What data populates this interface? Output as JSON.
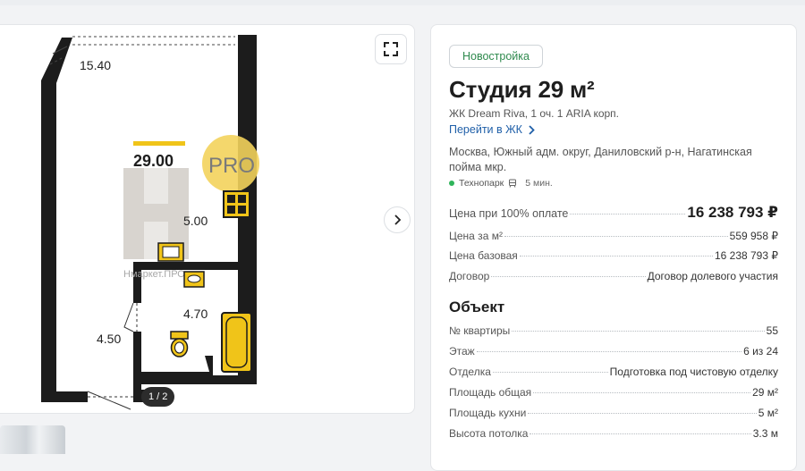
{
  "plan": {
    "dim_top": "15.40",
    "total_area": "29.00",
    "pro_label": "PRO",
    "kitchen_area": "5.00",
    "watermark": "Нмаркет.ПРО",
    "bath_area": "4.70",
    "hall_area": "4.50",
    "pager": "1 / 2"
  },
  "listing": {
    "badge": "Новостройка",
    "title": "Студия 29 м²",
    "subtitle": "ЖК Dream Riva, 1 оч. 1 ARIA корп.",
    "link": "Перейти в ЖК",
    "address": "Москва, Южный адм. округ, Даниловский р-н, Нагатинская пойма мкр.",
    "metro": {
      "station": "Технопарк",
      "time": "5 мин.",
      "color": "#2fb45a"
    }
  },
  "prices": [
    {
      "label": "Цена при 100% оплате",
      "value": "16 238 793 ₽"
    },
    {
      "label": "Цена за м²",
      "value": "559 958 ₽"
    },
    {
      "label": "Цена базовая",
      "value": "16 238 793 ₽"
    },
    {
      "label": "Договор",
      "value": "Договор долевого участия"
    }
  ],
  "object": {
    "heading": "Объект",
    "rows": [
      {
        "label": "№ квартиры",
        "value": "55"
      },
      {
        "label": "Этаж",
        "value": "6 из 24"
      },
      {
        "label": "Отделка",
        "value": "Подготовка под чистовую отделку"
      },
      {
        "label": "Площадь общая",
        "value": "29 м²"
      },
      {
        "label": "Площадь кухни",
        "value": "5 м²"
      },
      {
        "label": "Высота потолка",
        "value": "3.3 м"
      }
    ]
  }
}
